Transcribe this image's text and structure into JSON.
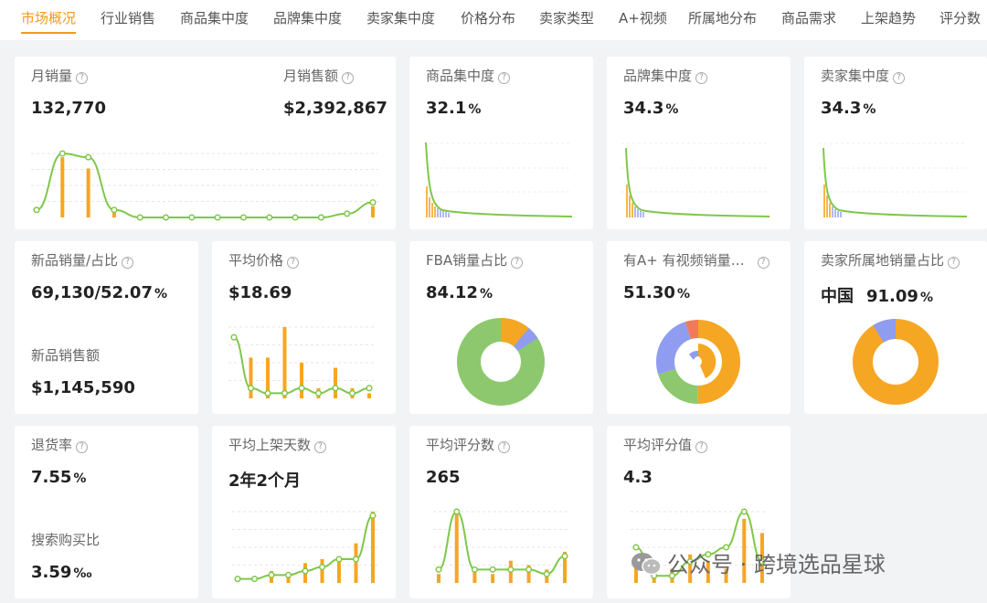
{
  "tabs": [
    {
      "label": "市场概况",
      "active": true
    },
    {
      "label": "行业销售"
    },
    {
      "label": "商品集中度"
    },
    {
      "label": "品牌集中度"
    },
    {
      "label": "卖家集中度"
    },
    {
      "label": "价格分布"
    },
    {
      "label": "卖家类型"
    },
    {
      "label": "A+视频"
    },
    {
      "label": "所属地分布"
    },
    {
      "label": "商品需求"
    },
    {
      "label": "上架趋势"
    },
    {
      "label": "评分数"
    }
  ],
  "cards": {
    "monthly_sales": {
      "label": "月销量",
      "value": "132,770"
    },
    "monthly_revenue": {
      "label": "月销售额",
      "value": "$2,392,867"
    },
    "product_concentration": {
      "label": "商品集中度",
      "value": "32.1",
      "unit": "%"
    },
    "brand_concentration": {
      "label": "品牌集中度",
      "value": "34.3",
      "unit": "%"
    },
    "seller_concentration": {
      "label": "卖家集中度",
      "value": "34.3",
      "unit": "%"
    },
    "new_products": {
      "label": "新品销量/占比",
      "value": "69,130/52.07",
      "unit": "%",
      "label2": "新品销售额",
      "value2": "$1,145,590"
    },
    "avg_price": {
      "label": "平均价格",
      "value": "$18.69"
    },
    "fba_share": {
      "label": "FBA销量占比",
      "value": "84.12",
      "unit": "%"
    },
    "aplus_video": {
      "label": "有A+ 有视频销量…",
      "value": "51.30",
      "unit": "%"
    },
    "seller_location": {
      "label": "卖家所属地销量占比",
      "country": "中国",
      "value": "91.09",
      "unit": "%"
    },
    "return_rate": {
      "label": "退货率",
      "value": "7.55",
      "unit": "%",
      "label2": "搜索购买比",
      "value2": "3.59",
      "unit2": "‰"
    },
    "avg_listing_days": {
      "label": "平均上架天数",
      "value": "2年2个月"
    },
    "avg_rating_count": {
      "label": "平均评分数",
      "value": "265"
    },
    "avg_rating": {
      "label": "平均评分值",
      "value": "4.3"
    }
  },
  "watermark": {
    "text": "公众号 · 跨境选品星球"
  },
  "colors": {
    "accent": "#f39a1b",
    "bar": "#f5a623",
    "line": "#7fc74a",
    "donut_green": "#8dc86f",
    "donut_orange": "#f5a623",
    "donut_purple": "#8f9cf0",
    "donut_red": "#f07b5a"
  },
  "chart_data": [
    {
      "id": "monthly",
      "type": "bar+line",
      "bars": [
        0,
        16,
        13,
        2,
        0,
        0,
        0,
        0,
        0,
        0,
        0,
        0,
        0,
        3
      ],
      "line": [
        2,
        17,
        16,
        2,
        0,
        0,
        0,
        0,
        0,
        0,
        0,
        0,
        1,
        4
      ]
    },
    {
      "id": "avg_price",
      "type": "bar+line",
      "bars": [
        0,
        8,
        8,
        14,
        7,
        2,
        6,
        2,
        1
      ],
      "line": [
        12,
        2,
        1,
        1,
        2,
        1,
        2,
        1,
        2
      ]
    },
    {
      "id": "listing_days",
      "type": "bar+line",
      "bars": [
        0,
        0,
        3,
        2,
        5,
        6,
        6,
        10,
        18
      ],
      "line": [
        1,
        1,
        2,
        2,
        3,
        4,
        6,
        6,
        17
      ]
    },
    {
      "id": "rating_count",
      "type": "bar+line",
      "bars": [
        2,
        16,
        3,
        2,
        5,
        4,
        3,
        7
      ],
      "line": [
        3,
        16,
        3,
        3,
        3,
        3,
        2,
        6
      ]
    },
    {
      "id": "rating",
      "type": "bar+line",
      "bars": [
        3,
        1,
        2,
        4,
        3,
        2,
        9,
        7
      ],
      "line": [
        5,
        1,
        1,
        3,
        4,
        5,
        10,
        3
      ]
    },
    {
      "id": "fba_donut",
      "type": "pie",
      "values": [
        84.12,
        11,
        4.88
      ]
    },
    {
      "id": "aplus_donut",
      "type": "pie",
      "values": [
        51.3,
        20,
        24,
        4.7
      ]
    },
    {
      "id": "location_donut",
      "type": "pie",
      "values": [
        91.09,
        8.91
      ]
    }
  ]
}
